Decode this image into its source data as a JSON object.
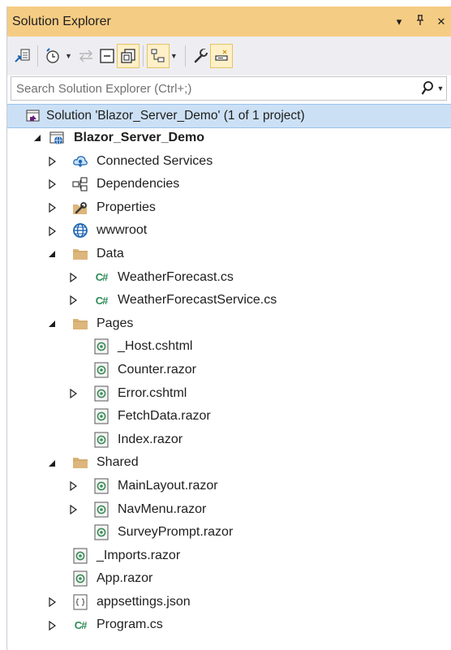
{
  "panel": {
    "title": "Solution Explorer",
    "controls": [
      "▾",
      "⊥",
      "✕"
    ]
  },
  "search": {
    "placeholder": "Search Solution Explorer (Ctrl+;)"
  },
  "solution": {
    "label": "Solution 'Blazor_Server_Demo' (1 of 1 project)"
  },
  "tree": [
    {
      "label": "Blazor_Server_Demo",
      "depth": 0,
      "expander": "expanded",
      "icon": "project-icon",
      "bold": true
    },
    {
      "label": "Connected Services",
      "depth": 1,
      "expander": "collapsed",
      "icon": "connected-services-icon"
    },
    {
      "label": "Dependencies",
      "depth": 1,
      "expander": "collapsed",
      "icon": "dependencies-icon"
    },
    {
      "label": "Properties",
      "depth": 1,
      "expander": "collapsed",
      "icon": "properties-icon"
    },
    {
      "label": "wwwroot",
      "depth": 1,
      "expander": "collapsed",
      "icon": "globe-icon"
    },
    {
      "label": "Data",
      "depth": 1,
      "expander": "expanded",
      "icon": "folder-icon"
    },
    {
      "label": "WeatherForecast.cs",
      "depth": 2,
      "expander": "collapsed",
      "icon": "csharp-icon"
    },
    {
      "label": "WeatherForecastService.cs",
      "depth": 2,
      "expander": "collapsed",
      "icon": "csharp-icon"
    },
    {
      "label": "Pages",
      "depth": 1,
      "expander": "expanded",
      "icon": "folder-icon"
    },
    {
      "label": "_Host.cshtml",
      "depth": 2,
      "expander": "none",
      "icon": "razor-icon"
    },
    {
      "label": "Counter.razor",
      "depth": 2,
      "expander": "none",
      "icon": "razor-icon"
    },
    {
      "label": "Error.cshtml",
      "depth": 2,
      "expander": "collapsed",
      "icon": "razor-icon"
    },
    {
      "label": "FetchData.razor",
      "depth": 2,
      "expander": "none",
      "icon": "razor-icon"
    },
    {
      "label": "Index.razor",
      "depth": 2,
      "expander": "none",
      "icon": "razor-icon"
    },
    {
      "label": "Shared",
      "depth": 1,
      "expander": "expanded",
      "icon": "folder-icon"
    },
    {
      "label": "MainLayout.razor",
      "depth": 2,
      "expander": "collapsed",
      "icon": "razor-icon"
    },
    {
      "label": "NavMenu.razor",
      "depth": 2,
      "expander": "collapsed",
      "icon": "razor-icon"
    },
    {
      "label": "SurveyPrompt.razor",
      "depth": 2,
      "expander": "none",
      "icon": "razor-icon"
    },
    {
      "label": "_Imports.razor",
      "depth": 1,
      "expander": "none",
      "icon": "razor-icon"
    },
    {
      "label": "App.razor",
      "depth": 1,
      "expander": "none",
      "icon": "razor-icon"
    },
    {
      "label": "appsettings.json",
      "depth": 1,
      "expander": "collapsed",
      "icon": "json-icon"
    },
    {
      "label": "Program.cs",
      "depth": 1,
      "expander": "collapsed",
      "icon": "csharp-icon"
    }
  ],
  "colors": {
    "title_bar": "#f5cc84",
    "toolbar": "#eeeef2",
    "selection": "#cce0f5",
    "folder": "#dcb67a",
    "csharp": "#2e8b57"
  }
}
